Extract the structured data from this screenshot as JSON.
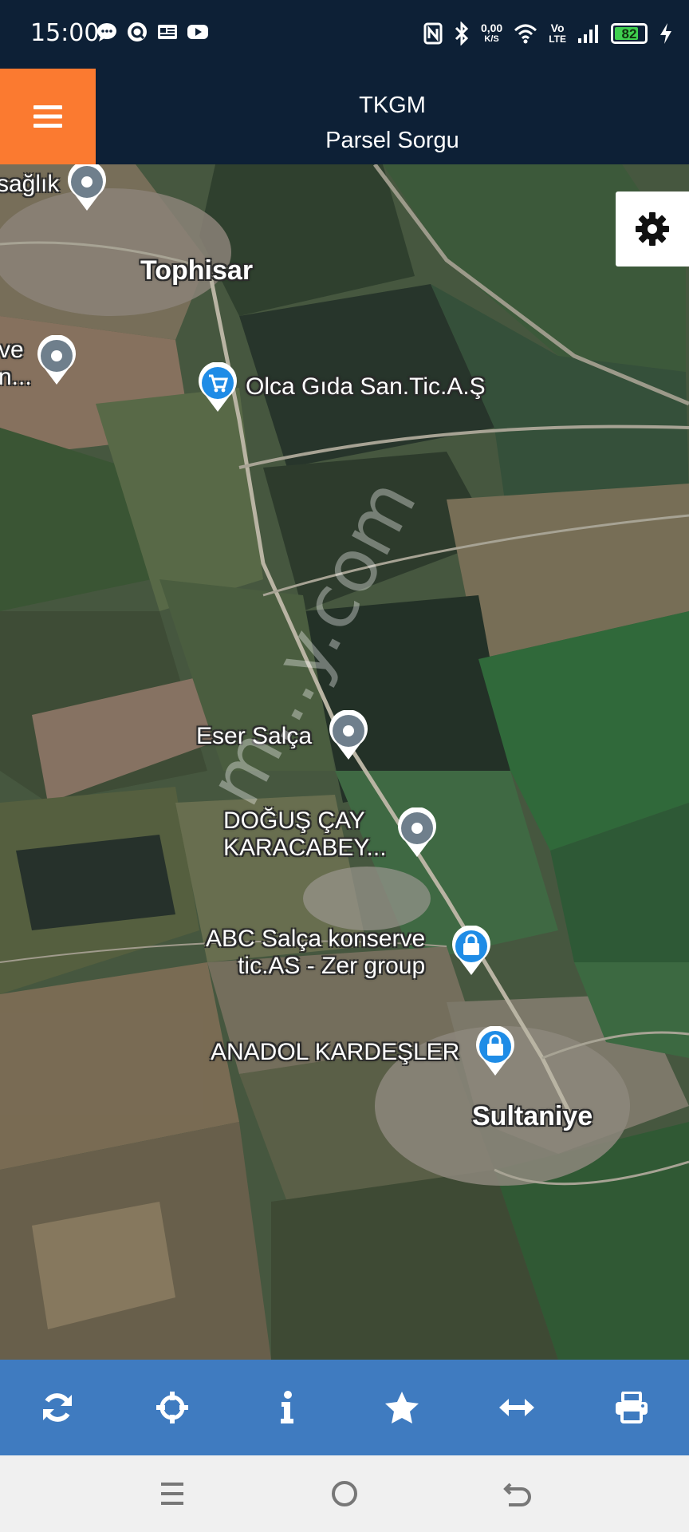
{
  "status_bar": {
    "time": "15:00",
    "net_speed_top": "0,00",
    "net_speed_bottom": "K/S",
    "volte_top": "Vo",
    "volte_bottom": "LTE",
    "battery": "82",
    "battery_level": 0.82,
    "left_icons": [
      "message-icon",
      "q-app-icon",
      "news-icon",
      "youtube-icon"
    ],
    "right_icons": [
      "nfc-icon",
      "bluetooth-icon",
      "wifi-icon",
      "signal-icon",
      "battery-icon",
      "charging-icon"
    ]
  },
  "header": {
    "title": "TKGM",
    "subtitle": "Parsel Sorgu",
    "menu_icon": "hamburger-menu-icon",
    "menu_color": "#fb7a30"
  },
  "map": {
    "labels": {
      "saglik": "sağlık",
      "tophisar": "Tophisar",
      "ve_line1": "ve",
      "ve_line2": "n...",
      "olca": "Olca Gıda San.Tic.A.Ş",
      "eser": "Eser Salça",
      "dogus_line1": "DOĞUŞ ÇAY",
      "dogus_line2": "KARACABEY...",
      "abc_line1": "ABC Salça konserve",
      "abc_line2": "tic.AS - Zer group",
      "anadol": "ANADOL KARDEŞLER",
      "sultaniye": "Sultaniye",
      "watermark": "m...y.com"
    },
    "settings_icon": "gear-icon"
  },
  "toolbar": {
    "background": "#3f7bc0",
    "buttons": [
      {
        "name": "refresh-button",
        "icon": "refresh-icon"
      },
      {
        "name": "locate-button",
        "icon": "crosshair-icon"
      },
      {
        "name": "info-button",
        "icon": "info-icon"
      },
      {
        "name": "favorite-button",
        "icon": "star-icon"
      },
      {
        "name": "measure-button",
        "icon": "horizontal-arrows-icon"
      },
      {
        "name": "print-button",
        "icon": "printer-icon"
      }
    ]
  },
  "nav_bar": {
    "buttons": [
      "recent-apps-icon",
      "home-icon",
      "back-icon"
    ]
  }
}
